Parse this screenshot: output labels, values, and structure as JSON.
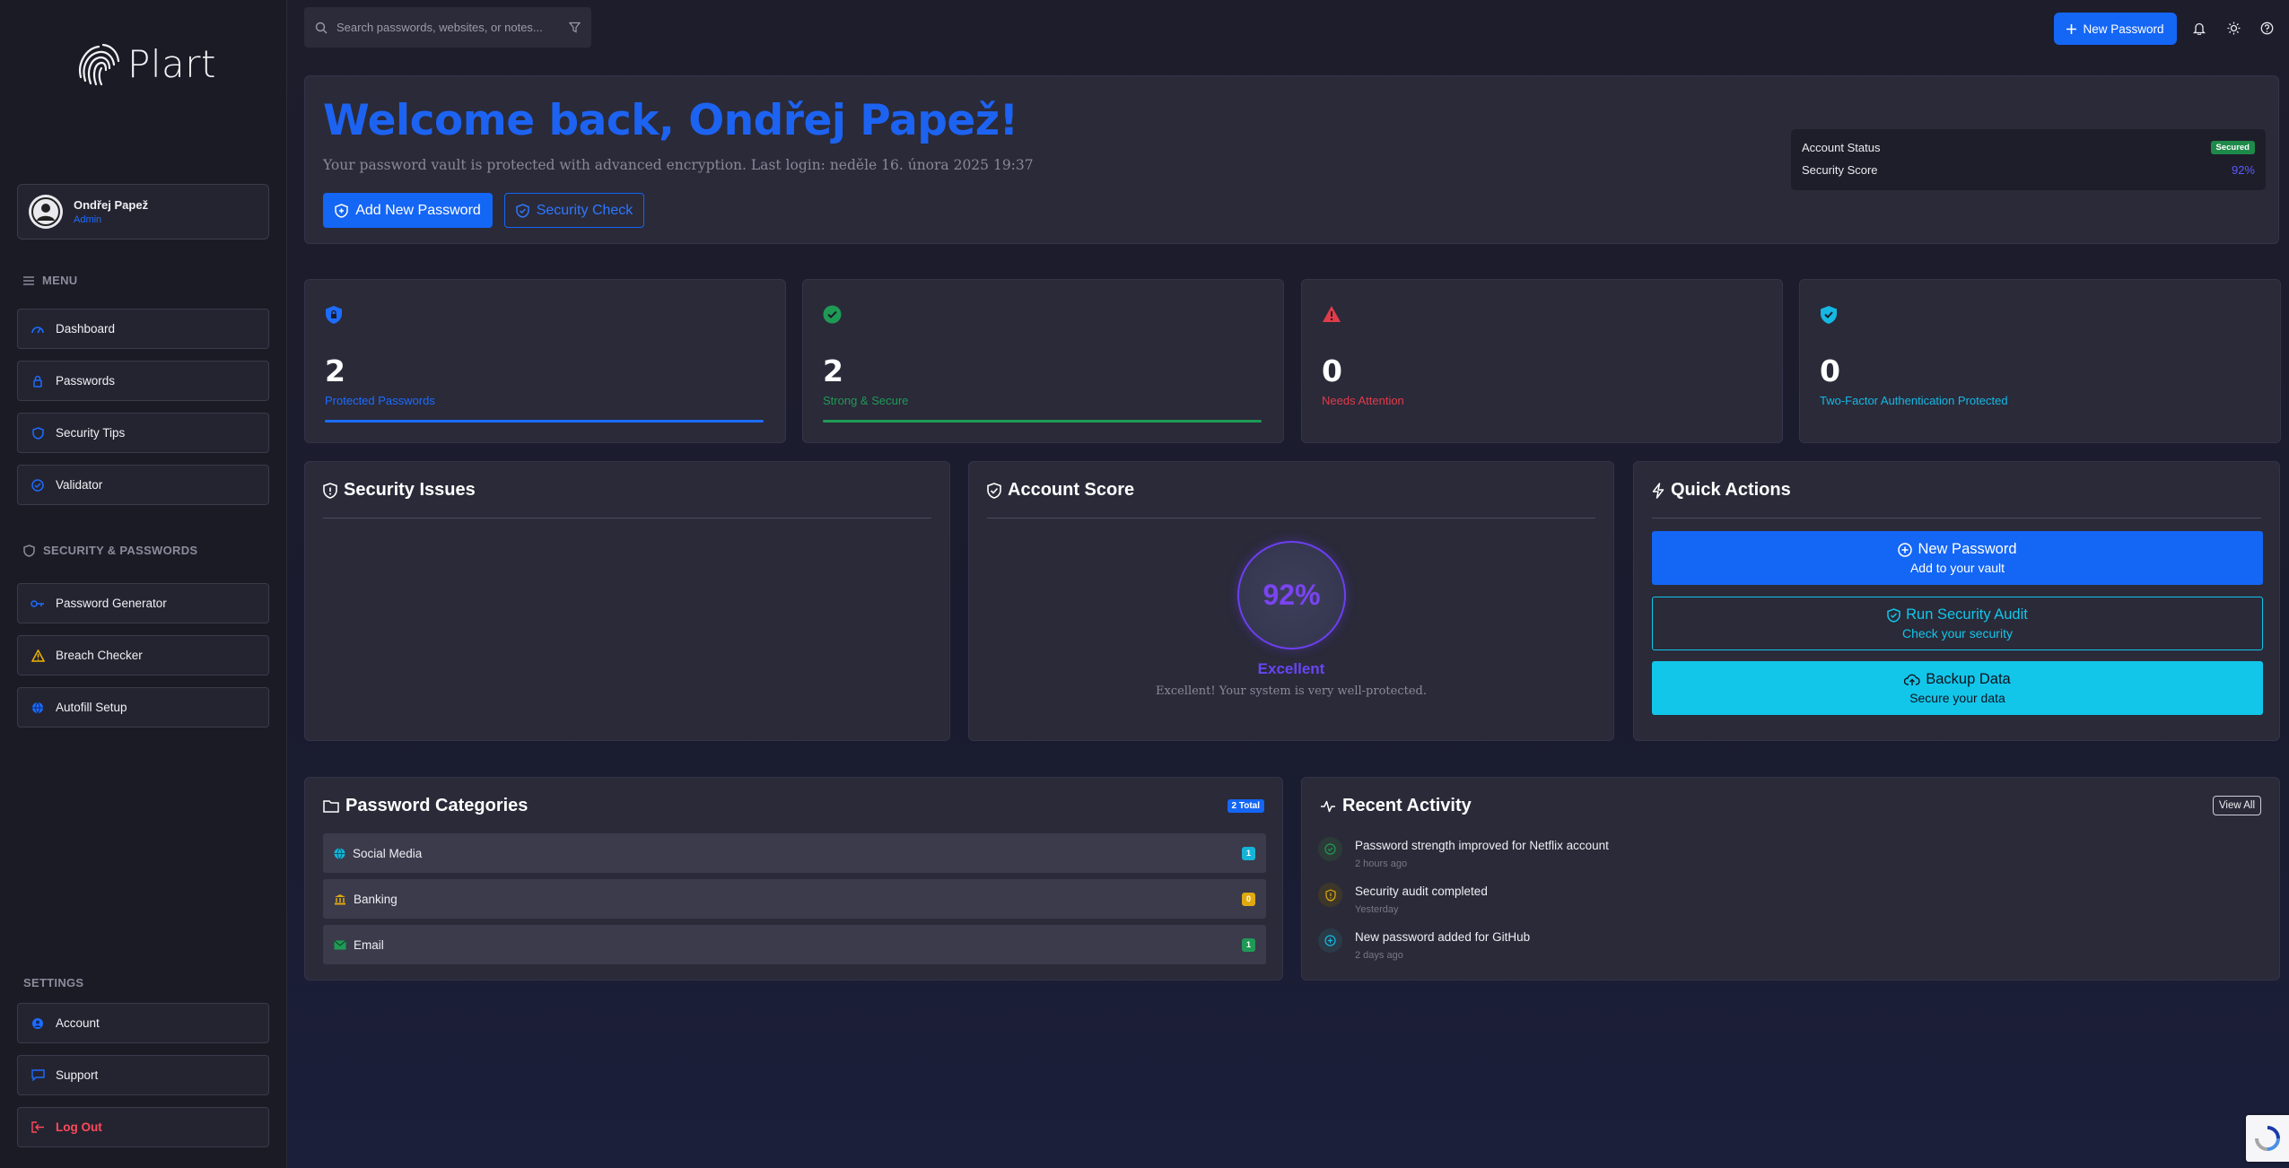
{
  "app": {
    "name": "Plart"
  },
  "user": {
    "name": "Ondřej Papež",
    "role": "Admin"
  },
  "sidebar": {
    "menu_label": "MENU",
    "menu_items": [
      {
        "label": "Dashboard",
        "icon": "gauge-icon"
      },
      {
        "label": "Passwords",
        "icon": "lock-icon"
      },
      {
        "label": "Security Tips",
        "icon": "shield-icon"
      },
      {
        "label": "Validator",
        "icon": "check-circle-icon"
      }
    ],
    "security_label": "SECURITY & PASSWORDS",
    "security_items": [
      {
        "label": "Password Generator",
        "icon": "key-icon"
      },
      {
        "label": "Breach Checker",
        "icon": "warning-icon"
      },
      {
        "label": "Autofill Setup",
        "icon": "globe-icon"
      }
    ],
    "settings_label": "SETTINGS",
    "settings_items": [
      {
        "label": "Account",
        "icon": "user-circle-icon"
      },
      {
        "label": "Support",
        "icon": "chat-icon"
      },
      {
        "label": "Log Out",
        "icon": "logout-icon"
      }
    ]
  },
  "topbar": {
    "search_placeholder": "Search passwords, websites, or notes...",
    "new_password_label": "New Password"
  },
  "welcome": {
    "title": "Welcome back, Ondřej Papež!",
    "subtitle": "Your password vault is protected with advanced encryption. Last login: neděle 16. února 2025 19:37",
    "add_button": "Add New Password",
    "check_button": "Security Check",
    "account_status_label": "Account Status",
    "account_status_value": "Secured",
    "security_score_label": "Security Score",
    "security_score_value": "92%"
  },
  "stats": [
    {
      "value": "2",
      "label": "Protected Passwords",
      "color": "#1d6cff",
      "icon": "shield-lock-icon"
    },
    {
      "value": "2",
      "label": "Strong & Secure",
      "color": "#1f9a55",
      "icon": "check-circle-icon"
    },
    {
      "value": "0",
      "label": "Needs Attention",
      "color": "#e23b4a",
      "icon": "warning-icon"
    },
    {
      "value": "0",
      "label": "Two-Factor Authentication Protected",
      "color": "#16b8e3",
      "icon": "shield-check-icon"
    }
  ],
  "security_issues": {
    "title": "Security Issues"
  },
  "account_score": {
    "title": "Account Score",
    "score": "92%",
    "rating": "Excellent",
    "description": "Excellent! Your system is very well-protected."
  },
  "quick_actions": {
    "title": "Quick Actions",
    "items": [
      {
        "label": "New Password",
        "sub": "Add to your vault"
      },
      {
        "label": "Run Security Audit",
        "sub": "Check your security"
      },
      {
        "label": "Backup Data",
        "sub": "Secure your data"
      }
    ]
  },
  "categories": {
    "title": "Password Categories",
    "badge": "2 Total",
    "items": [
      {
        "label": "Social Media",
        "count": "1",
        "color": "#14b4d8"
      },
      {
        "label": "Banking",
        "count": "0",
        "color": "#e0a90f"
      },
      {
        "label": "Email",
        "count": "1",
        "color": "#1f9a55"
      }
    ]
  },
  "activity": {
    "title": "Recent Activity",
    "view_all": "View All",
    "items": [
      {
        "text": "Password strength improved for Netflix account",
        "time": "2 hours ago"
      },
      {
        "text": "Security audit completed",
        "time": "Yesterday"
      },
      {
        "text": "New password added for GitHub",
        "time": "2 days ago"
      }
    ]
  },
  "colors": {
    "accent": "#1466f5",
    "cyan": "#12c6ea",
    "purple": "#6c3ff0",
    "danger": "#ff4a5a"
  }
}
